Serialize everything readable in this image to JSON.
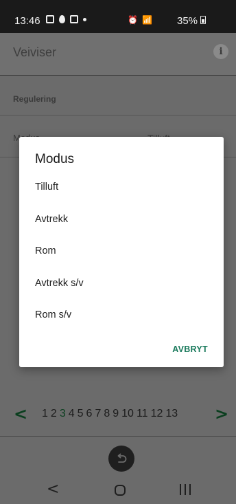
{
  "status_bar": {
    "time": "13:46",
    "battery": "35%"
  },
  "app": {
    "title": "Veiviser",
    "info_icon": "i",
    "section": "Regulering",
    "mode_row": {
      "label": "Modus",
      "value": "Tilluft"
    }
  },
  "pager": {
    "prev": "<",
    "next": ">",
    "pages": [
      "1",
      "2",
      "3",
      "4",
      "5",
      "6",
      "7",
      "8",
      "9",
      "10",
      "11",
      "12",
      "13"
    ],
    "current": "3"
  },
  "dialog": {
    "title": "Modus",
    "options": [
      "Tilluft",
      "Avtrekk",
      "Rom",
      "Avtrekk s/v",
      "Rom s/v"
    ],
    "cancel_label": "AVBRYT"
  },
  "nav": {
    "back": "<"
  },
  "colors": {
    "accent": "#1a7a5c",
    "pager_arrow": "#0b3f1f",
    "scrim": "#6b6b6b"
  }
}
